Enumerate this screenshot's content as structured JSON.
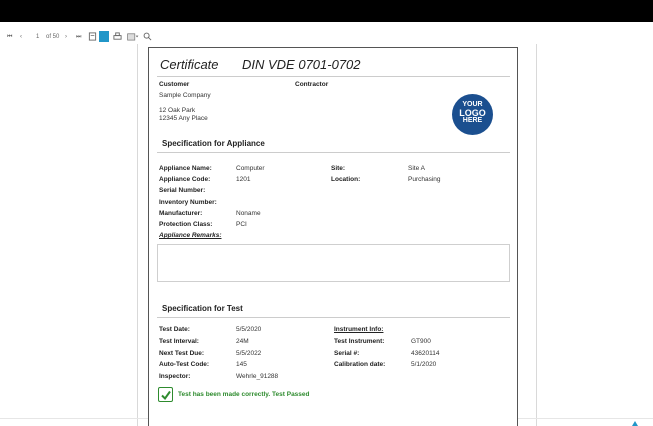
{
  "toolbar": {
    "first_icon": "first-page-icon",
    "prev_icon": "prev-page-icon",
    "page_current": "1",
    "page_of": "of 50",
    "next_icon": "next-page-icon",
    "last_icon": "last-page-icon"
  },
  "certificate": {
    "title": "Certificate",
    "standard": "DIN VDE 0701-0702",
    "customer_label": "Customer",
    "contractor_label": "Contractor",
    "customer_name": "Sample Company",
    "address_line1": "12 Oak Park",
    "address_line2": "12345 Any Place",
    "logo": [
      "YOUR",
      "LOGO",
      "HERE"
    ]
  },
  "appliance": {
    "section_title": "Specification for Appliance",
    "name_label": "Appliance Name:",
    "name_value": "Computer",
    "code_label": "Appliance Code:",
    "code_value": "1201",
    "serial_label": "Serial Number:",
    "inventory_label": "Inventory Number:",
    "manufacturer_label": "Manufacturer:",
    "manufacturer_value": "Noname",
    "protection_label": "Protection Class:",
    "protection_value": "PCI",
    "remarks_label": "Appliance Remarks:",
    "site_label": "Site:",
    "site_value": "Site A",
    "location_label": "Location:",
    "location_value": "Purchasing"
  },
  "test": {
    "section_title": "Specification for Test",
    "date_label": "Test Date:",
    "date_value": "5/5/2020",
    "interval_label": "Test Interval:",
    "interval_value": "24M",
    "next_label": "Next Test Due:",
    "next_value": "5/5/2022",
    "auto_label": "Auto-Test Code:",
    "auto_value": "145",
    "inspector_label": "Inspector:",
    "inspector_value": "Wehrle_91288",
    "instrument_info_label": "Instrument Info:",
    "instrument_label": "Test Instrument:",
    "instrument_value": "GT900",
    "serial_label": "Serial #:",
    "serial_value": "43620114",
    "calibration_label": "Calibration date:",
    "calibration_value": "5/1/2020",
    "result_text": "Test has been made correctly. Test Passed"
  },
  "colors": {
    "accent_button": "#2196c8",
    "logo_blue": "#1b4f8f",
    "pass_green": "#2e8b2e"
  }
}
